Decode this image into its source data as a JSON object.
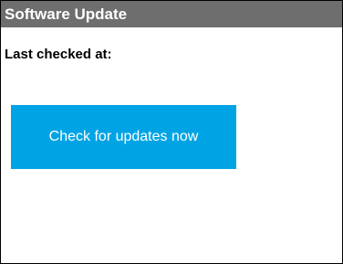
{
  "window": {
    "title": "Software Update"
  },
  "status": {
    "last_checked_label": "Last checked at:"
  },
  "actions": {
    "check_button_label": "Check for updates now"
  },
  "colors": {
    "title_bar": "#6e6e6e",
    "accent_button": "#00a4e4"
  }
}
